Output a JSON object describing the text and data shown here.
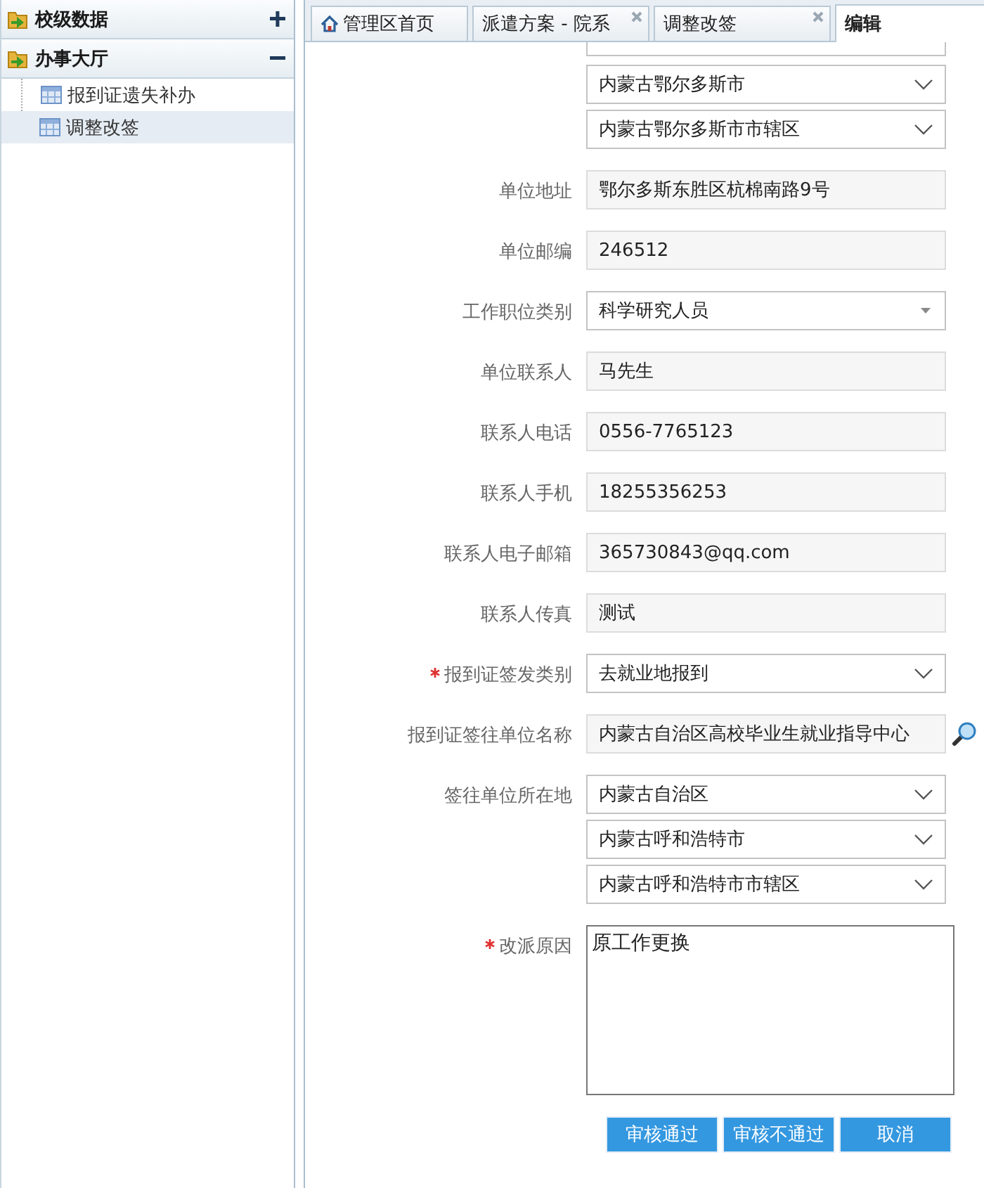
{
  "sidebar": {
    "groups": [
      {
        "label": "校级数据",
        "expanded": false
      },
      {
        "label": "办事大厅",
        "expanded": true,
        "children": [
          {
            "label": "报到证遗失补办",
            "selected": false
          },
          {
            "label": "调整改签",
            "selected": true
          }
        ]
      }
    ]
  },
  "tabs": [
    {
      "label": "管理区首页",
      "kind": "home",
      "selected": false
    },
    {
      "label": "派遣方案 - 院系",
      "kind": "closable",
      "selected": false
    },
    {
      "label": "调整改签",
      "kind": "closable",
      "selected": false
    },
    {
      "label": "编辑",
      "kind": "plain",
      "selected": true
    }
  ],
  "form": {
    "rows": [
      {
        "kind": "partial",
        "fields": [
          {
            "kind": "select"
          }
        ]
      },
      {
        "fields": [
          {
            "kind": "select",
            "value": "内蒙古鄂尔多斯市"
          },
          {
            "kind": "select",
            "value": "内蒙古鄂尔多斯市市辖区"
          }
        ]
      },
      {
        "label": "单位地址",
        "required": false,
        "fields": [
          {
            "kind": "text",
            "value": "鄂尔多斯东胜区杭棉南路9号"
          }
        ]
      },
      {
        "label": "单位邮编",
        "required": false,
        "fields": [
          {
            "kind": "text",
            "value": "246512"
          }
        ]
      },
      {
        "label": "工作职位类别",
        "required": false,
        "fields": [
          {
            "kind": "combo",
            "value": "科学研究人员"
          }
        ]
      },
      {
        "label": "单位联系人",
        "required": false,
        "fields": [
          {
            "kind": "text",
            "value": "马先生"
          }
        ]
      },
      {
        "label": "联系人电话",
        "required": false,
        "fields": [
          {
            "kind": "text",
            "value": "0556-7765123"
          }
        ]
      },
      {
        "label": "联系人手机",
        "required": false,
        "fields": [
          {
            "kind": "text",
            "value": "18255356253"
          }
        ]
      },
      {
        "label": "联系人电子邮箱",
        "required": false,
        "fields": [
          {
            "kind": "text",
            "value": "365730843@qq.com"
          }
        ]
      },
      {
        "label": "联系人传真",
        "required": false,
        "fields": [
          {
            "kind": "text",
            "value": "测试"
          }
        ]
      },
      {
        "label": "报到证签发类别",
        "required": true,
        "fields": [
          {
            "kind": "select",
            "value": "去就业地报到"
          }
        ]
      },
      {
        "label": "报到证签往单位名称",
        "required": false,
        "fields": [
          {
            "kind": "lookup",
            "value": "内蒙古自治区高校毕业生就业指导中心"
          }
        ]
      },
      {
        "label": "签往单位所在地",
        "required": false,
        "fields": [
          {
            "kind": "select",
            "value": "内蒙古自治区"
          },
          {
            "kind": "select",
            "value": "内蒙古呼和浩特市"
          },
          {
            "kind": "select",
            "value": "内蒙古呼和浩特市市辖区"
          }
        ]
      },
      {
        "label": "改派原因",
        "required": true,
        "fields": [
          {
            "kind": "textarea",
            "value": "原工作更换"
          }
        ]
      }
    ],
    "buttons": [
      "审核通过",
      "审核不通过",
      "取消"
    ]
  }
}
